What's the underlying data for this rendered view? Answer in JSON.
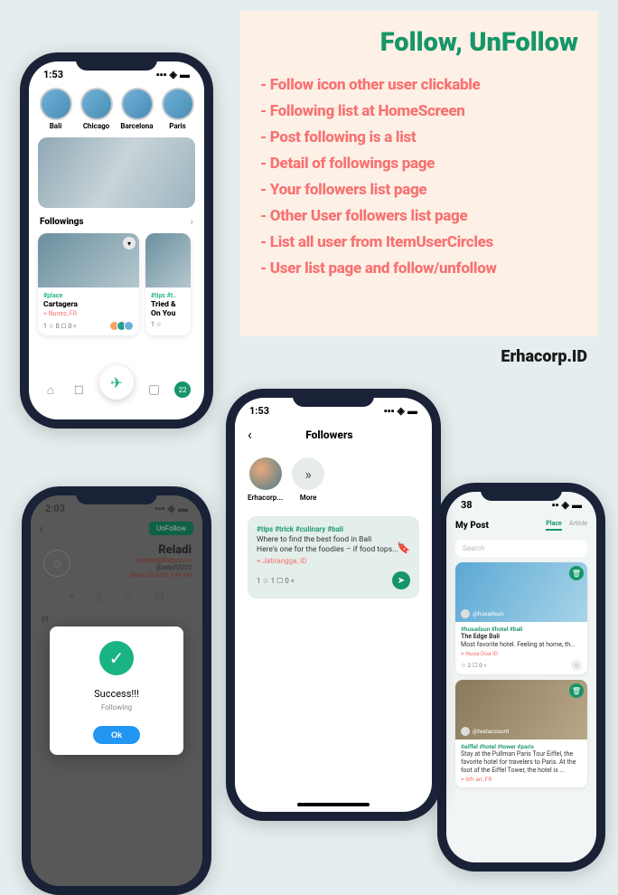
{
  "header": {
    "title": "Follow, UnFollow",
    "features": [
      "- Follow icon other user clickable",
      "- Following list at HomeScreen",
      "- Post following is a list",
      "- Detail of followings page",
      "- Your followers list page",
      "- Other User followers list page",
      "- List all user from ItemUserCircles",
      "- User list page and follow/unfollow"
    ],
    "credit": "Erhacorp.ID"
  },
  "phones": {
    "home": {
      "time": "1:53",
      "stories": [
        {
          "name": "Bali"
        },
        {
          "name": "Chicago"
        },
        {
          "name": "Barcelona"
        },
        {
          "name": "Paris"
        }
      ],
      "followings_label": "Followings",
      "cards": [
        {
          "tag": "#place",
          "title": "Cartagera",
          "loc": "⌖ Nunez, FR",
          "stats": "1 ☆   0 ☐   0 <"
        },
        {
          "tag": "#tips #t..",
          "title": "Tried &\nOn You",
          "loc": "",
          "stats": "1 ☆"
        }
      ],
      "nav_badge": "22"
    },
    "unfollow": {
      "time": "2:03",
      "chip": "UnFollow",
      "name": "Reladi",
      "email": "contact@thetync.vn",
      "handle": "@reladi2022",
      "since": "Since 2022/02 2:49 AM",
      "tab_left": "Pl",
      "dialog": {
        "title": "Success!!!",
        "sub": "Following",
        "ok": "Ok"
      }
    },
    "followers": {
      "time": "1:53",
      "title": "Followers",
      "users": [
        {
          "name": "Erhacorp..."
        },
        {
          "name": "More"
        }
      ],
      "post": {
        "tags": "#tips #trick #culinary #bali",
        "text": "Where to find the best food in Bali\nHere's one for the foodies – if food tops...",
        "loc": "⌖ Jatirangga, ID",
        "stats": "1 ☆   1 ☐   0 <"
      }
    },
    "mypost": {
      "time": "38",
      "title": "My Post",
      "tabs": {
        "active": "Place",
        "other": "Article"
      },
      "search": "Search",
      "cards": [
        {
          "handle": "@husadsun",
          "tags": "#husadsun #hotel #bali",
          "title": "The Edge Bali",
          "text": "Most favorite hotel. Feeling at home, th...",
          "loc": "⌖ Nusa Dua ID",
          "stats": "☆ 2 ☐ 0 <"
        },
        {
          "handle": "@testaccount",
          "tags": "#eiffel #hotel #tower #paris",
          "text": "Stay at the Pullman Paris Tour Eiffel, the favorite hotel for travelers to Paris. At the foot of the Eiffel Tower, the hotel is ...",
          "loc": "⌖ 6th arr, FR"
        }
      ]
    }
  }
}
